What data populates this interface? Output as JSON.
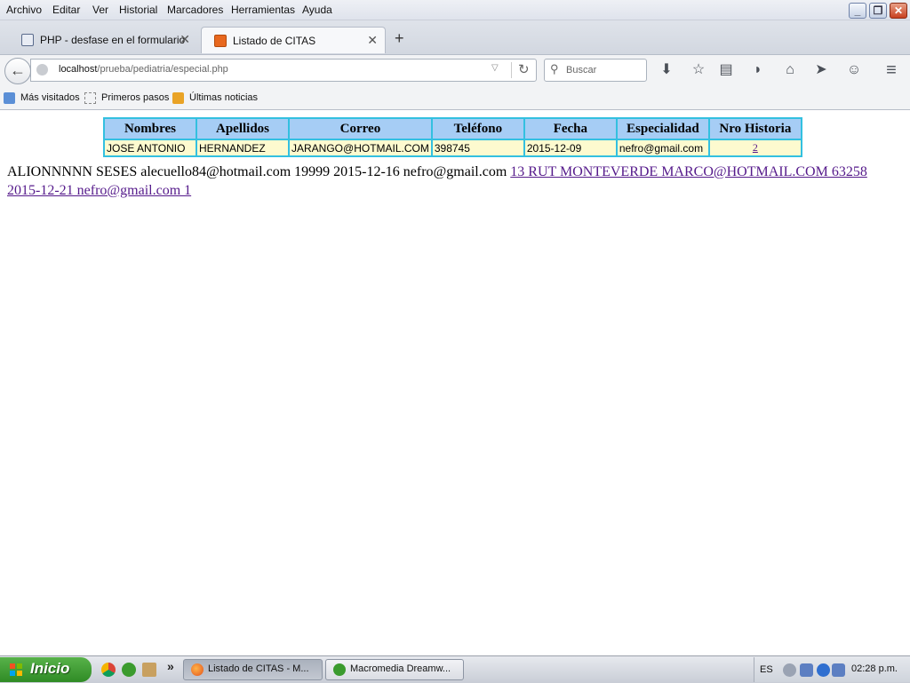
{
  "menubar": {
    "items": [
      "Archivo",
      "Editar",
      "Ver",
      "Historial",
      "Marcadores",
      "Herramientas",
      "Ayuda"
    ],
    "window_buttons": {
      "minimize": "_",
      "restore": "❐",
      "close": "✕"
    }
  },
  "tabs": [
    {
      "title": "PHP - desfase en el formulario",
      "icon": "document-icon",
      "close": "✕"
    },
    {
      "title": "Listado de CITAS",
      "icon": "xampp-icon",
      "close": "✕"
    }
  ],
  "new_tab": "+",
  "navbar": {
    "url_host": "localhost",
    "url_path": "/prueba/pediatria/especial.php",
    "search_placeholder": "Buscar",
    "back": "←",
    "reload": "↻",
    "dropdown": "▽",
    "search_glyph": "⚲",
    "toolbar_glyphs": {
      "download": "⬇",
      "bookmark": "☆",
      "reader": "▤",
      "pocket": "◗",
      "home": "⌂",
      "send": "➤",
      "chat": "☺",
      "menu": "≡"
    }
  },
  "bookmarks": [
    {
      "label": "Más visitados",
      "icon": "most-visited-icon"
    },
    {
      "label": "Primeros pasos",
      "icon": "page-icon"
    },
    {
      "label": "Últimas noticias",
      "icon": "rss-icon"
    }
  ],
  "table": {
    "headers": [
      "Nombres",
      "Apellidos",
      "Correo",
      "Teléfono",
      "Fecha",
      "Especialidad",
      "Nro Historia"
    ],
    "rows": [
      [
        "JOSE ANTONIO",
        "HERNANDEZ",
        "JARANGO@HOTMAIL.COM",
        "398745",
        "2015-12-09",
        "nefro@gmail.com",
        "2"
      ]
    ]
  },
  "paragraph": {
    "plain": "ALIONNNNN SESES alecuello84@hotmail.com 19999 2015-12-16 nefro@gmail.com ",
    "link": "13 RUT MONTEVERDE MARCO@HOTMAIL.COM 63258 2015-12-21 nefro@gmail.com 1"
  },
  "taskbar": {
    "start_label": "Inicio",
    "more": "»",
    "tasks": [
      {
        "label": "Listado de CITAS - M...",
        "icon": "firefox-icon"
      },
      {
        "label": "Macromedia Dreamw...",
        "icon": "dreamweaver-icon"
      }
    ],
    "tray": {
      "language": "ES",
      "clock": "02:28 p.m."
    }
  }
}
